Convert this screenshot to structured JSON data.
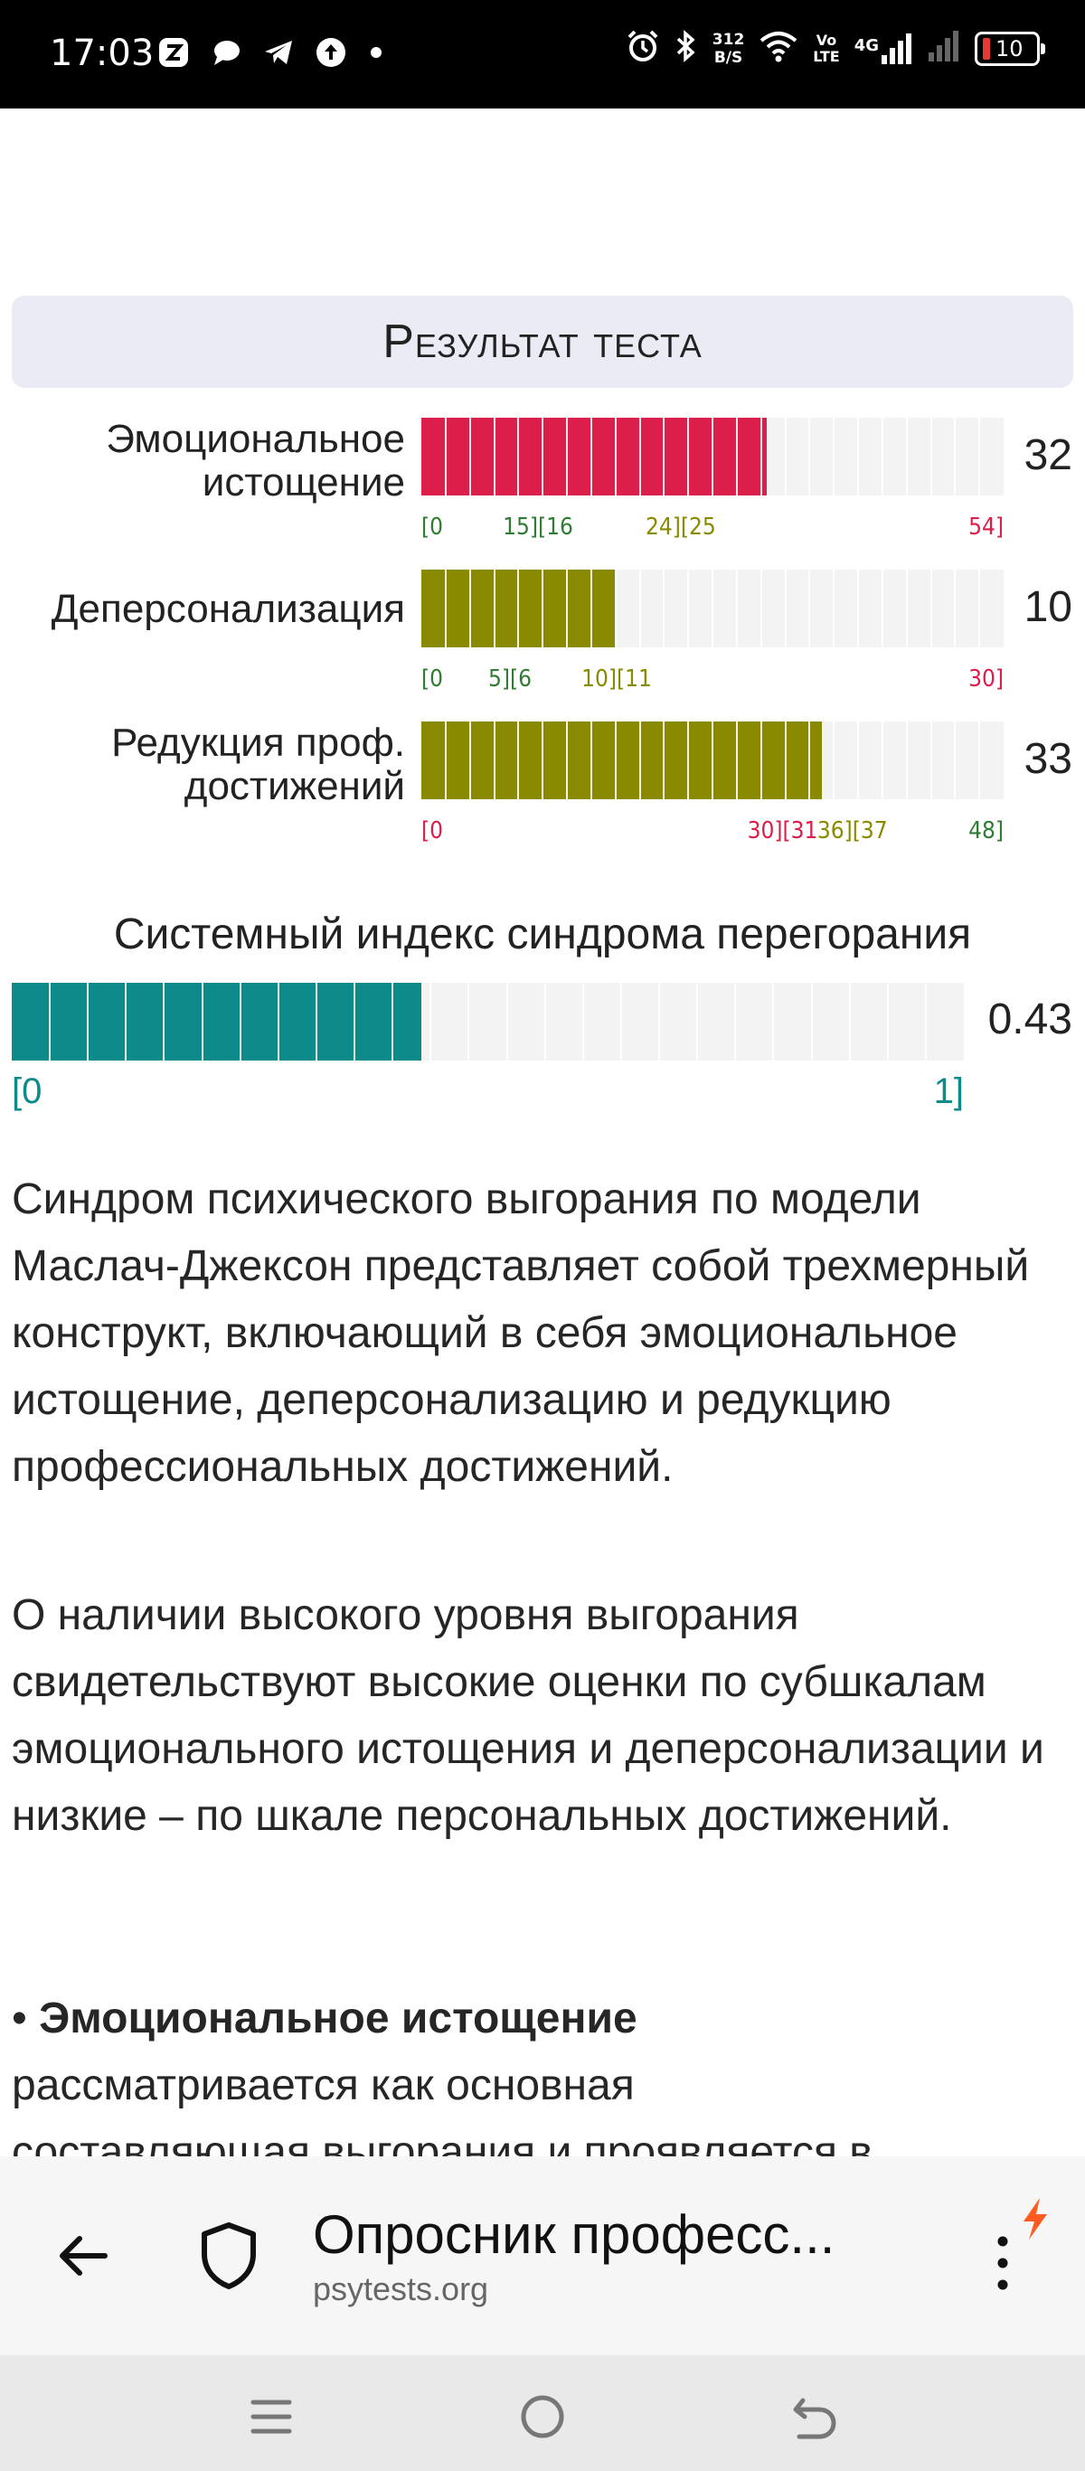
{
  "status_bar": {
    "time": "17:03",
    "net_speed_value": "312",
    "net_speed_unit": "B/S",
    "volte_top": "Vo",
    "volte_bottom": "LTE",
    "network_type": "4G",
    "battery": "10"
  },
  "result": {
    "title": "Результат теста",
    "scales": [
      {
        "label_line1": "Эмоциональное",
        "label_line2": "истощение",
        "score": "32",
        "fraction": 0.593,
        "color": "#dc1e4a",
        "ticks": [
          {
            "text": "[0",
            "color": "#2e7d32"
          },
          {
            "text": "15][16",
            "color": "#2e7d32"
          },
          {
            "text": "24][25",
            "color": "#8a8a00"
          },
          {
            "text": "54]",
            "color": "#dc1e4a"
          }
        ]
      },
      {
        "label_line1": "Деперсонализация",
        "label_line2": "",
        "score": "10",
        "fraction": 0.333,
        "color": "#8a8a00",
        "ticks": [
          {
            "text": "[0",
            "color": "#2e7d32"
          },
          {
            "text": "5][6",
            "color": "#2e7d32"
          },
          {
            "text": "10][11",
            "color": "#8a8a00"
          },
          {
            "text": "30]",
            "color": "#dc1e4a"
          }
        ]
      },
      {
        "label_line1": "Редукция проф.",
        "label_line2": "достижений",
        "score": "33",
        "fraction": 0.688,
        "color": "#8a8a00",
        "ticks": [
          {
            "text": "[0",
            "color": "#dc1e4a"
          },
          {
            "text": "30][31",
            "color": "#dc1e4a"
          },
          {
            "text": "36][37",
            "color": "#8a8a00"
          },
          {
            "text": "48]",
            "color": "#2e7d32"
          }
        ]
      }
    ],
    "index": {
      "title": "Системный индекс синдрома перегорания",
      "score": "0.43",
      "fraction": 0.43,
      "color": "#0d8a8a",
      "tick_start": "[0",
      "tick_end": "1]"
    }
  },
  "article": {
    "p1": "Синдром психического выгорания по модели Маслач-Джексон представляет собой трехмерный конструкт, включающий в себя эмоциональное истощение, деперсонализацию и редукцию профессиональных достижений.",
    "p2": "О наличии высокого уровня выгорания свидетельствуют высокие оценки по субшкалам эмоционального истощения и деперсонализации и низкие – по шкале персональных достижений.",
    "bullet_marker": "•",
    "bullet_title": "Эмоциональное истощение",
    "bullet_line2": "рассматривается как основная",
    "bullet_line3": "составляющая выгорания и проявляется в"
  },
  "browser": {
    "page_title": "Опросник професс...",
    "url": "psytests.org"
  },
  "icons": {
    "back": "arrow-left-icon",
    "security": "shield-icon",
    "menu": "more-vertical-icon",
    "turbo": "lightning-icon"
  }
}
